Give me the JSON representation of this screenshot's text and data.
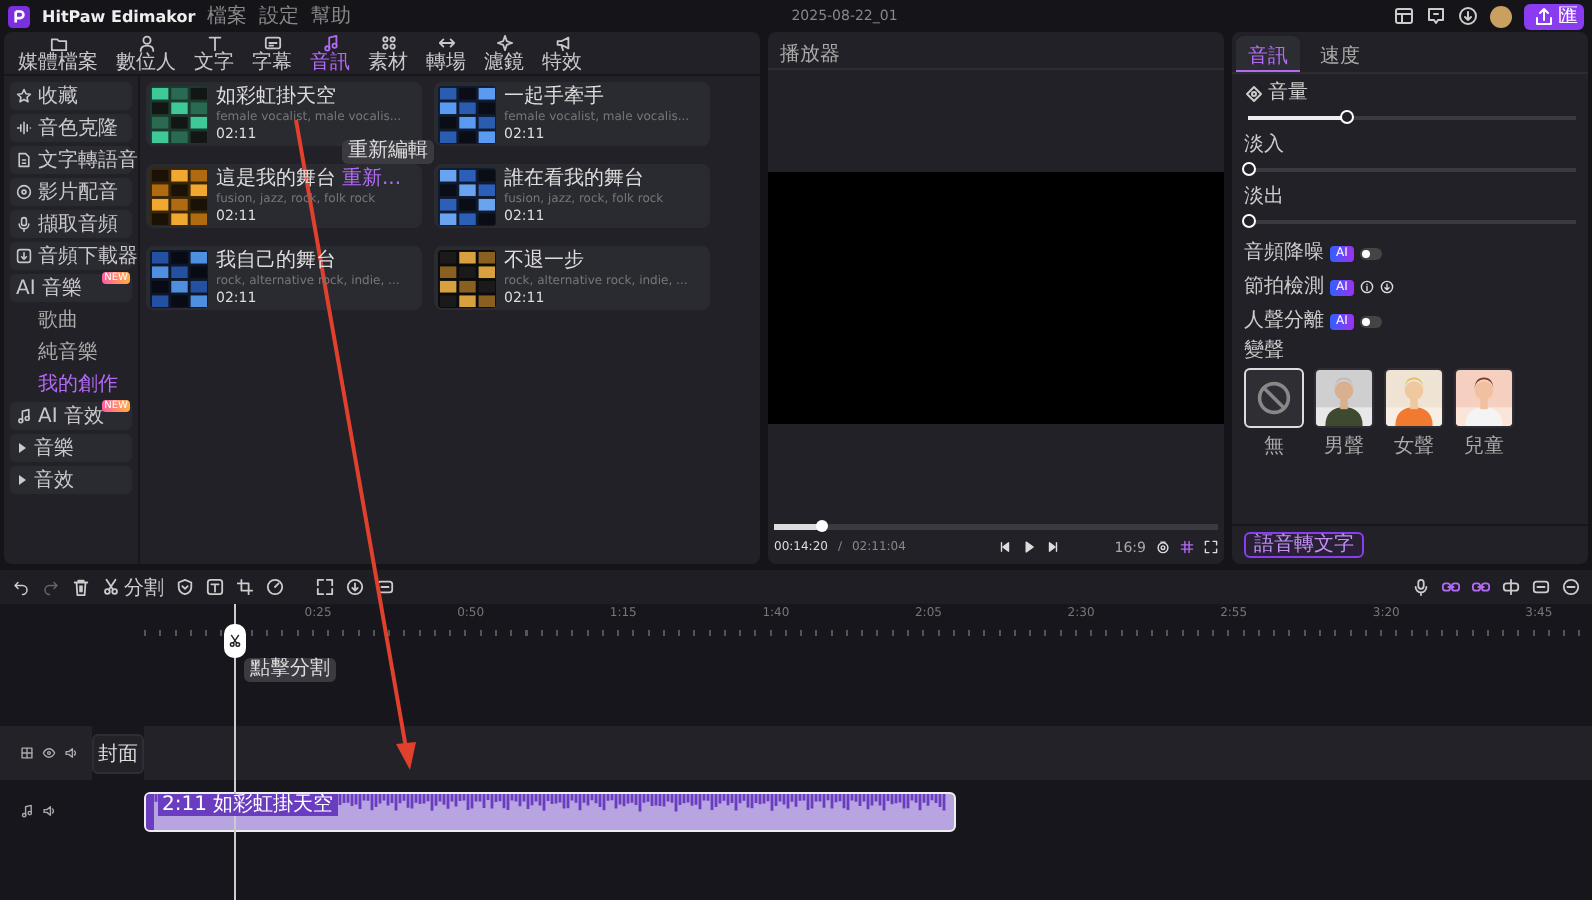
{
  "app": {
    "name": "HitPaw Edimakor",
    "menu": [
      "檔案",
      "設定",
      "幫助"
    ],
    "project_title": "2025-08-22_01",
    "export_label": "匯"
  },
  "toolbar": [
    {
      "label": "媒體檔案",
      "selected": false
    },
    {
      "label": "數位人",
      "selected": false
    },
    {
      "label": "文字",
      "selected": false
    },
    {
      "label": "字幕",
      "selected": false
    },
    {
      "label": "音訊",
      "selected": true
    },
    {
      "label": "素材",
      "selected": false
    },
    {
      "label": "轉場",
      "selected": false
    },
    {
      "label": "濾鏡",
      "selected": false
    },
    {
      "label": "特效",
      "selected": false
    }
  ],
  "sidebar": [
    {
      "label": "收藏",
      "selected": false
    },
    {
      "label": "音色克隆",
      "selected": false
    },
    {
      "label": "文字轉語音",
      "selected": false
    },
    {
      "label": "影片配音",
      "selected": false
    },
    {
      "label": "擷取音頻",
      "selected": false
    },
    {
      "label": "音頻下載器",
      "selected": false
    },
    {
      "label": "AI 音樂",
      "badge": "NEW",
      "selected": false,
      "expanded": true,
      "children": [
        {
          "label": "歌曲",
          "selected": false
        },
        {
          "label": "純音樂",
          "selected": false
        },
        {
          "label": "我的創作",
          "selected": true
        }
      ]
    },
    {
      "label": "AI 音效",
      "badge": "NEW",
      "selected": false
    },
    {
      "label": "音樂",
      "selected": false,
      "expanded": false
    },
    {
      "label": "音效",
      "selected": false,
      "expanded": false
    }
  ],
  "cards": [
    {
      "title": "如彩虹掛天空",
      "tags": "female vocalist, male vocalis...",
      "duration": "02:11",
      "tooltip": "重新編輯"
    },
    {
      "title": "一起手牽手",
      "tags": "female vocalist, male vocalis...",
      "duration": "02:11"
    },
    {
      "title": "這是我的舞台",
      "tags": "fusion, jazz, rock, folk rock",
      "duration": "02:11",
      "action": "重新..."
    },
    {
      "title": "誰在看我的舞台",
      "tags": "fusion, jazz, rock, folk rock",
      "duration": "02:11"
    },
    {
      "title": "我自己的舞台",
      "tags": "rock, alternative rock, indie, ...",
      "duration": "02:11"
    },
    {
      "title": "不退一步",
      "tags": "rock, alternative rock, indie, ...",
      "duration": "02:11"
    }
  ],
  "player": {
    "title": "播放器",
    "current_time": "00:14:20",
    "separator": "/",
    "total_time": "02:11:04",
    "level": 0.11,
    "aspect_ratio": "16:9"
  },
  "properties": {
    "tabs": [
      {
        "label": "音訊",
        "selected": true
      },
      {
        "label": "速度",
        "selected": false
      }
    ],
    "sliders": [
      {
        "label": "音量",
        "level": 0.3
      },
      {
        "label": "淡入",
        "level": 0
      },
      {
        "label": "淡出",
        "level": 0
      }
    ],
    "options": [
      {
        "kind": "toggle",
        "label": "音頻降噪",
        "badge": "AI",
        "on": false
      },
      {
        "kind": "info",
        "label": "節拍檢測",
        "badge": "AI"
      },
      {
        "kind": "toggle",
        "label": "人聲分離",
        "badge": "AI",
        "on": false
      }
    ],
    "voice_changer": {
      "label": "變聲",
      "voices": [
        {
          "label": "無",
          "selected": true
        },
        {
          "label": "男聲",
          "selected": false
        },
        {
          "label": "女聲",
          "selected": false
        },
        {
          "label": "兒童",
          "selected": false
        }
      ]
    },
    "transcribe_button": "語音轉文字"
  },
  "timeline": {
    "split_label": "分割",
    "ticks": [
      "0:25",
      "0:50",
      "1:15",
      "1:40",
      "2:05",
      "2:30",
      "2:55",
      "3:20",
      "3:45"
    ],
    "playhead_tooltip": "點擊分割",
    "cover_label": "封面",
    "clip": {
      "label": "2:11 如彩虹掛天空"
    }
  }
}
